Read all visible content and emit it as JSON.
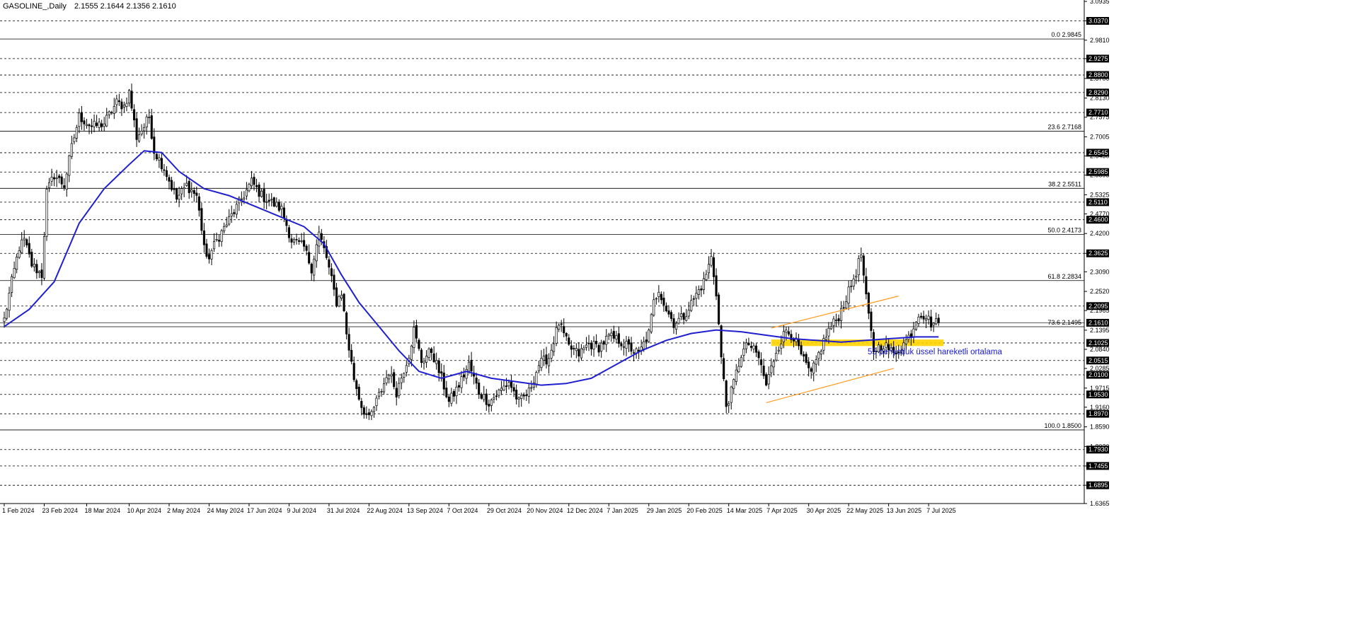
{
  "header": {
    "symbol": "GASOLINE_,Daily",
    "ohlc": "2.1555 2.1644 2.1356 2.1610"
  },
  "colors": {
    "background": "#ffffff",
    "candle": "#000000",
    "ema": "#1f1fcf",
    "channel": "#ff9a1f",
    "zone": "#ffd400",
    "annotation": "#1a1acd",
    "level_dashed": "#000000",
    "fib_solid": "#000000"
  },
  "annotation": "55 periyotluk üssel hareketli ortalama",
  "chart_data": {
    "type": "candlestick",
    "title": "GASOLINE_,Daily",
    "ylim": [
      1.6365,
      3.0935
    ],
    "y_ticks": [
      "3.0935",
      "3.0370",
      "2.9810",
      "2.9275",
      "2.8700",
      "2.8130",
      "2.7575",
      "2.7005",
      "2.6450",
      "2.5895",
      "2.5325",
      "2.4770",
      "2.4200",
      "2.3625",
      "2.3090",
      "2.2520",
      "2.1965",
      "2.1395",
      "2.0840",
      "2.0285",
      "1.9715",
      "1.9160",
      "1.8590",
      "1.8020",
      "1.7455",
      "1.6895",
      "1.6365"
    ],
    "x_ticks": [
      {
        "label": "1 Feb 2024",
        "idx": 0
      },
      {
        "label": "23 Feb 2024",
        "idx": 16
      },
      {
        "label": "18 Mar 2024",
        "idx": 33
      },
      {
        "label": "10 Apr 2024",
        "idx": 50
      },
      {
        "label": "2 May 2024",
        "idx": 66
      },
      {
        "label": "24 May 2024",
        "idx": 82
      },
      {
        "label": "17 Jun 2024",
        "idx": 98
      },
      {
        "label": "9 Jul 2024",
        "idx": 114
      },
      {
        "label": "31 Jul 2024",
        "idx": 130
      },
      {
        "label": "22 Aug 2024",
        "idx": 146
      },
      {
        "label": "13 Sep 2024",
        "idx": 162
      },
      {
        "label": "7 Oct 2024",
        "idx": 178
      },
      {
        "label": "29 Oct 2024",
        "idx": 194
      },
      {
        "label": "20 Nov 2024",
        "idx": 210
      },
      {
        "label": "12 Dec 2024",
        "idx": 226
      },
      {
        "label": "7 Jan 2025",
        "idx": 242
      },
      {
        "label": "29 Jan 2025",
        "idx": 258
      },
      {
        "label": "20 Feb 2025",
        "idx": 274
      },
      {
        "label": "14 Mar 2025",
        "idx": 290
      },
      {
        "label": "7 Apr 2025",
        "idx": 306
      },
      {
        "label": "30 Apr 2025",
        "idx": 322
      },
      {
        "label": "22 May 2025",
        "idx": 338
      },
      {
        "label": "13 Jun 2025",
        "idx": 354
      },
      {
        "label": "7 Jul 2025",
        "idx": 370
      }
    ],
    "n_bars": 375,
    "levels_dashed": [
      {
        "label": "3.0370",
        "value": 3.037
      },
      {
        "label": "2.9275",
        "value": 2.9275
      },
      {
        "label": "2.8800",
        "value": 2.88
      },
      {
        "label": "2.8290",
        "value": 2.829
      },
      {
        "label": "2.7710",
        "value": 2.771
      },
      {
        "label": "2.6545",
        "value": 2.6545
      },
      {
        "label": "2.5985",
        "value": 2.5985
      },
      {
        "label": "2.5110",
        "value": 2.511
      },
      {
        "label": "2.4600",
        "value": 2.46
      },
      {
        "label": "2.3625",
        "value": 2.3625
      },
      {
        "label": "2.2095",
        "value": 2.2095
      },
      {
        "label": "2.1025",
        "value": 2.1025
      },
      {
        "label": "2.0515",
        "value": 2.0515
      },
      {
        "label": "2.0100",
        "value": 2.01
      },
      {
        "label": "1.9530",
        "value": 1.953
      },
      {
        "label": "1.8970",
        "value": 1.897
      },
      {
        "label": "1.7930",
        "value": 1.793
      },
      {
        "label": "1.7455",
        "value": 1.7455
      },
      {
        "label": "1.6895",
        "value": 1.6895
      }
    ],
    "fib_levels": [
      {
        "label": "0.0 2.9845",
        "value": 2.9845
      },
      {
        "label": "23.6 2.7168",
        "value": 2.7168
      },
      {
        "label": "38.2 2.5511",
        "value": 2.5511
      },
      {
        "label": "50.0 2.4173",
        "value": 2.4173
      },
      {
        "label": "61.8 2.2834",
        "value": 2.2834
      },
      {
        "label": "73.6 2.1495",
        "value": 2.1495
      },
      {
        "label": "100.0 1.8500",
        "value": 1.85
      }
    ],
    "current_price": {
      "label": "2.1610",
      "value": 2.161
    },
    "zone": {
      "from_idx": 307,
      "to_idx": 376,
      "low": 2.0935,
      "high": 2.1125
    },
    "channel": [
      {
        "x1": 307,
        "y1": 2.1455,
        "x2": 358,
        "y2": 2.2385
      },
      {
        "x1": 305,
        "y1": 1.929,
        "x2": 356,
        "y2": 2.0285
      }
    ],
    "price_anchors": [
      [
        0,
        2.17
      ],
      [
        3,
        2.28
      ],
      [
        6,
        2.38
      ],
      [
        8,
        2.4
      ],
      [
        11,
        2.33
      ],
      [
        15,
        2.3
      ],
      [
        17,
        2.54
      ],
      [
        20,
        2.59
      ],
      [
        24,
        2.56
      ],
      [
        27,
        2.67
      ],
      [
        30,
        2.76
      ],
      [
        35,
        2.73
      ],
      [
        40,
        2.74
      ],
      [
        45,
        2.8
      ],
      [
        48,
        2.79
      ],
      [
        50,
        2.83
      ],
      [
        53,
        2.7
      ],
      [
        56,
        2.73
      ],
      [
        58,
        2.76
      ],
      [
        60,
        2.66
      ],
      [
        64,
        2.61
      ],
      [
        69,
        2.52
      ],
      [
        73,
        2.56
      ],
      [
        77,
        2.53
      ],
      [
        81,
        2.34
      ],
      [
        85,
        2.4
      ],
      [
        90,
        2.46
      ],
      [
        95,
        2.52
      ],
      [
        99,
        2.57
      ],
      [
        103,
        2.53
      ],
      [
        107,
        2.51
      ],
      [
        111,
        2.49
      ],
      [
        115,
        2.4
      ],
      [
        120,
        2.38
      ],
      [
        123,
        2.32
      ],
      [
        126,
        2.42
      ],
      [
        129,
        2.35
      ],
      [
        133,
        2.22
      ],
      [
        135,
        2.25
      ],
      [
        137,
        2.13
      ],
      [
        140,
        2.0
      ],
      [
        143,
        1.92
      ],
      [
        146,
        1.88
      ],
      [
        150,
        1.95
      ],
      [
        154,
        2.02
      ],
      [
        157,
        1.96
      ],
      [
        162,
        2.07
      ],
      [
        164,
        2.14
      ],
      [
        167,
        2.05
      ],
      [
        171,
        2.08
      ],
      [
        175,
        2.0
      ],
      [
        178,
        1.93
      ],
      [
        182,
        1.98
      ],
      [
        186,
        2.04
      ],
      [
        190,
        1.96
      ],
      [
        194,
        1.93
      ],
      [
        198,
        1.96
      ],
      [
        202,
        1.99
      ],
      [
        206,
        1.93
      ],
      [
        210,
        1.96
      ],
      [
        214,
        2.04
      ],
      [
        218,
        2.06
      ],
      [
        222,
        2.16
      ],
      [
        226,
        2.09
      ],
      [
        230,
        2.07
      ],
      [
        234,
        2.1
      ],
      [
        238,
        2.09
      ],
      [
        242,
        2.12
      ],
      [
        246,
        2.11
      ],
      [
        250,
        2.09
      ],
      [
        254,
        2.07
      ],
      [
        258,
        2.13
      ],
      [
        260,
        2.22
      ],
      [
        262,
        2.26
      ],
      [
        265,
        2.2
      ],
      [
        268,
        2.16
      ],
      [
        272,
        2.18
      ],
      [
        276,
        2.23
      ],
      [
        280,
        2.28
      ],
      [
        283,
        2.35
      ],
      [
        285,
        2.25
      ],
      [
        287,
        2.06
      ],
      [
        289,
        1.92
      ],
      [
        291,
        1.96
      ],
      [
        295,
        2.07
      ],
      [
        298,
        2.1
      ],
      [
        302,
        2.06
      ],
      [
        305,
        1.98
      ],
      [
        309,
        2.08
      ],
      [
        313,
        2.14
      ],
      [
        316,
        2.12
      ],
      [
        320,
        2.05
      ],
      [
        323,
        2.01
      ],
      [
        327,
        2.09
      ],
      [
        330,
        2.14
      ],
      [
        334,
        2.18
      ],
      [
        338,
        2.25
      ],
      [
        341,
        2.31
      ],
      [
        343,
        2.36
      ],
      [
        345,
        2.23
      ],
      [
        348,
        2.08
      ],
      [
        352,
        2.1
      ],
      [
        356,
        2.07
      ],
      [
        360,
        2.1
      ],
      [
        363,
        2.13
      ],
      [
        366,
        2.19
      ],
      [
        369,
        2.18
      ],
      [
        371,
        2.16
      ],
      [
        374,
        2.161
      ]
    ],
    "ema_anchors": [
      [
        0,
        2.15
      ],
      [
        10,
        2.2
      ],
      [
        20,
        2.28
      ],
      [
        30,
        2.45
      ],
      [
        40,
        2.55
      ],
      [
        50,
        2.62
      ],
      [
        56,
        2.66
      ],
      [
        63,
        2.655
      ],
      [
        70,
        2.6
      ],
      [
        80,
        2.55
      ],
      [
        90,
        2.53
      ],
      [
        100,
        2.5
      ],
      [
        110,
        2.47
      ],
      [
        120,
        2.44
      ],
      [
        128,
        2.39
      ],
      [
        135,
        2.3
      ],
      [
        142,
        2.22
      ],
      [
        150,
        2.15
      ],
      [
        158,
        2.08
      ],
      [
        166,
        2.02
      ],
      [
        175,
        2.0
      ],
      [
        185,
        2.02
      ],
      [
        195,
        2.0
      ],
      [
        205,
        1.99
      ],
      [
        215,
        1.98
      ],
      [
        225,
        1.985
      ],
      [
        235,
        2.0
      ],
      [
        245,
        2.04
      ],
      [
        255,
        2.08
      ],
      [
        265,
        2.11
      ],
      [
        275,
        2.13
      ],
      [
        285,
        2.14
      ],
      [
        295,
        2.135
      ],
      [
        305,
        2.125
      ],
      [
        315,
        2.115
      ],
      [
        325,
        2.11
      ],
      [
        335,
        2.105
      ],
      [
        345,
        2.11
      ],
      [
        355,
        2.115
      ],
      [
        365,
        2.12
      ],
      [
        374,
        2.12
      ]
    ]
  }
}
